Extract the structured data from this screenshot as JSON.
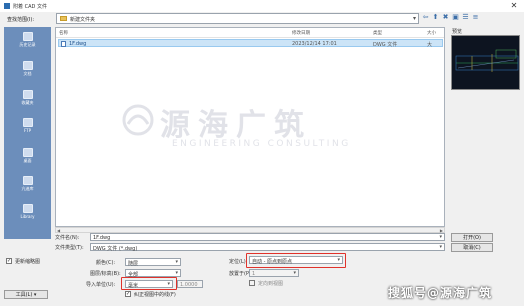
{
  "window": {
    "title": "附着 CAD 文件",
    "close_glyph": "✕"
  },
  "lookin": {
    "label": "查找范围(I):",
    "value": "新建文件夹",
    "arrow": "▾"
  },
  "nav": {
    "back": "⇦",
    "up": "⬆",
    "delete": "✖",
    "new_folder": "▣",
    "views": "☰",
    "tools": "≡"
  },
  "places": [
    {
      "label": "历史记录"
    },
    {
      "label": "文档"
    },
    {
      "label": "收藏夹"
    },
    {
      "label": "FTP"
    },
    {
      "label": "桌面"
    },
    {
      "label": "亢迪库"
    },
    {
      "label": "Library"
    }
  ],
  "filelist": {
    "headers": {
      "name": "名称",
      "date": "修改日期",
      "type": "类型",
      "size": "大小"
    },
    "rows": [
      {
        "name": "1F.dwg",
        "date": "2023/12/14 17:01",
        "type": "DWG 文件",
        "size": "大"
      }
    ]
  },
  "watermark": {
    "title": "源海广筑",
    "subtitle": "ENGINEERING CONSULTING"
  },
  "preview": {
    "label": "预览"
  },
  "filename": {
    "label": "文件名(N):",
    "value": "1F.dwg"
  },
  "filetype": {
    "label": "文件类型(T):",
    "value": "DWG 文件 (*.dwg)"
  },
  "options": {
    "update_preview": {
      "label": "更新缩略图"
    },
    "color_label": "颜色(C):",
    "color_value": "随层",
    "layer_label": "图层/标高(B):",
    "layer_value": "全部",
    "units_label": "导入单位(U):",
    "units_value": "毫米",
    "units_extra": "1.0000",
    "position_label": "定位(L):",
    "position_value": "自动 - 原点到原点",
    "place_at_label": "放置于(P):",
    "place_at_value": "1",
    "correct_label": "纠正视图中的线(F)",
    "orient_label": "定向到视图"
  },
  "buttons": {
    "tools": "工具(L)",
    "open": "打开(O)",
    "cancel": "取消(C)"
  },
  "footer_watermark": "搜狐号@源海广筑"
}
